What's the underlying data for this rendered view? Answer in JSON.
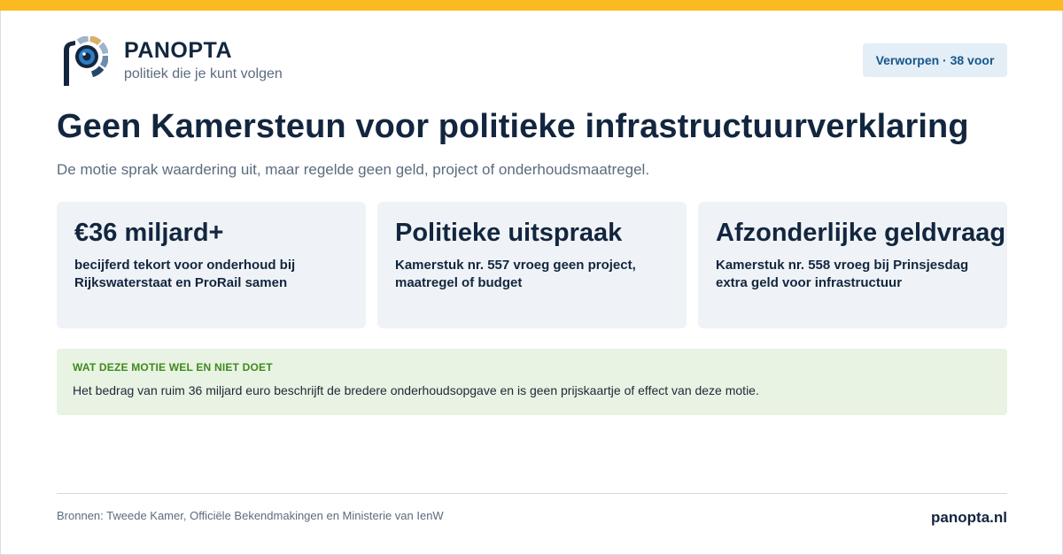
{
  "brand": {
    "name": "PANOPTA",
    "tagline": "politiek die je kunt volgen",
    "website": "panopta.nl"
  },
  "status_badge": "Verworpen · 38 voor",
  "headline": "Geen Kamersteun voor politieke infrastructuurverklaring",
  "subheadline": "De motie sprak waardering uit, maar regelde geen geld, project of onderhoudsmaatregel.",
  "cards": [
    {
      "title": "€36 miljard+",
      "body": "becijferd tekort voor onderhoud bij Rijkswaterstaat en ProRail samen"
    },
    {
      "title": "Politieke uitspraak",
      "body": "Kamerstuk nr. 557 vroeg geen project, maatregel of budget"
    },
    {
      "title": "Afzonderlijke geldvraag",
      "body": "Kamerstuk nr. 558 vroeg bij Prinsjesdag extra geld voor infrastructuur"
    }
  ],
  "note": {
    "label": "WAT DEZE MOTIE WEL EN NIET DOET",
    "text": "Het bedrag van ruim 36 miljard euro beschrijft de bredere onderhoudsopgave en is geen prijskaartje of effect van deze motie."
  },
  "footer": {
    "sources": "Bronnen: Tweede Kamer, Officiële Bekendmakingen en Ministerie van IenW"
  },
  "colors": {
    "accent_bar": "#fbba1f",
    "navy": "#13263f",
    "badge_bg": "#e3eef6",
    "badge_text": "#17568a",
    "card_bg": "#eff3f7",
    "note_bg": "#e8f3e3",
    "note_label": "#3d8a1e"
  },
  "icons": {
    "logo": "panopta-eye-logo"
  }
}
